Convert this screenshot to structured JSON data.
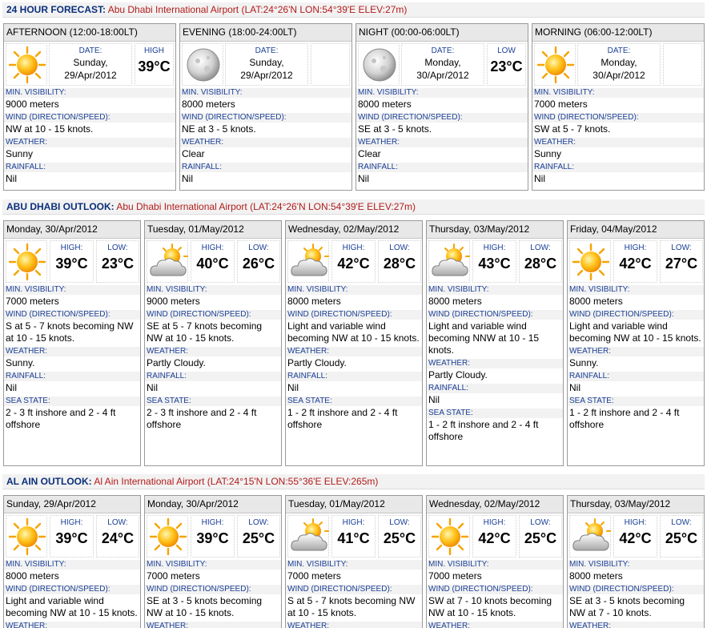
{
  "forecast24": {
    "title": "24 HOUR FORECAST:",
    "location": "Abu Dhabi International Airport (LAT:24°26'N LON:54°39'E ELEV:27m)",
    "cards": [
      {
        "period": "AFTERNOON (12:00-18:00LT)",
        "icon": "sun-icon",
        "date_label": "DATE:",
        "date_line1": "Sunday,",
        "date_line2": "29/Apr/2012",
        "temp_label": "HIGH",
        "temp": "39°C",
        "vis_label": "MIN. VISIBILITY:",
        "vis": "9000 meters",
        "wind_label": "WIND (DIRECTION/SPEED):",
        "wind": "NW at 10 - 15 knots.",
        "weather_label": "WEATHER:",
        "weather": "Sunny",
        "rain_label": "RAINFALL:",
        "rain": "Nil"
      },
      {
        "period": "EVENING (18:00-24:00LT)",
        "icon": "moon-icon",
        "date_label": "DATE:",
        "date_line1": "Sunday,",
        "date_line2": "29/Apr/2012",
        "temp_label": "",
        "temp": "",
        "vis_label": "MIN. VISIBILITY:",
        "vis": "8000 meters",
        "wind_label": "WIND (DIRECTION/SPEED):",
        "wind": "NE at 3 - 5 knots.",
        "weather_label": "WEATHER:",
        "weather": "Clear",
        "rain_label": "RAINFALL:",
        "rain": "Nil"
      },
      {
        "period": "NIGHT (00:00-06:00LT)",
        "icon": "moon-icon",
        "date_label": "DATE:",
        "date_line1": "Monday,",
        "date_line2": "30/Apr/2012",
        "temp_label": "LOW",
        "temp": "23°C",
        "vis_label": "MIN. VISIBILITY:",
        "vis": "8000 meters",
        "wind_label": "WIND (DIRECTION/SPEED):",
        "wind": "SE at 3 - 5 knots.",
        "weather_label": "WEATHER:",
        "weather": "Clear",
        "rain_label": "RAINFALL:",
        "rain": "Nil"
      },
      {
        "period": "MORNING (06:00-12:00LT)",
        "icon": "sun-icon",
        "date_label": "DATE:",
        "date_line1": "Monday,",
        "date_line2": "30/Apr/2012",
        "temp_label": "",
        "temp": "",
        "vis_label": "MIN. VISIBILITY:",
        "vis": "7000 meters",
        "wind_label": "WIND (DIRECTION/SPEED):",
        "wind": "SW at 5 - 7 knots.",
        "weather_label": "WEATHER:",
        "weather": "Sunny",
        "rain_label": "RAINFALL:",
        "rain": "Nil"
      }
    ]
  },
  "abudhabi": {
    "title": "ABU DHABI OUTLOOK:",
    "location": "Abu Dhabi International Airport (LAT:24°26'N LON:54°39'E ELEV:27m)",
    "cards": [
      {
        "day": "Monday, 30/Apr/2012",
        "icon": "sun-icon",
        "high_label": "HIGH:",
        "high": "39°C",
        "low_label": "LOW:",
        "low": "23°C",
        "vis_label": "MIN. VISIBILITY:",
        "vis": "7000 meters",
        "wind_label": "WIND (DIRECTION/SPEED):",
        "wind": "S at 5 - 7 knots becoming NW at 10 - 15 knots.",
        "weather_label": "WEATHER:",
        "weather": "Sunny.",
        "rain_label": "RAINFALL:",
        "rain": "Nil",
        "sea_label": "SEA STATE:",
        "sea": "2 - 3 ft inshore and 2 - 4 ft offshore"
      },
      {
        "day": "Tuesday, 01/May/2012",
        "icon": "partly-cloudy-icon",
        "high_label": "HIGH:",
        "high": "40°C",
        "low_label": "LOW:",
        "low": "26°C",
        "vis_label": "MIN. VISIBILITY:",
        "vis": "9000 meters",
        "wind_label": "WIND (DIRECTION/SPEED):",
        "wind": "SE at 5 - 7 knots becoming NW at 10 - 15 knots.",
        "weather_label": "WEATHER:",
        "weather": "Partly Cloudy.",
        "rain_label": "RAINFALL:",
        "rain": "Nil",
        "sea_label": "SEA STATE:",
        "sea": "2 - 3 ft inshore and 2 - 4 ft offshore"
      },
      {
        "day": "Wednesday, 02/May/2012",
        "icon": "partly-cloudy-icon",
        "high_label": "HIGH:",
        "high": "42°C",
        "low_label": "LOW:",
        "low": "28°C",
        "vis_label": "MIN. VISIBILITY:",
        "vis": "8000 meters",
        "wind_label": "WIND (DIRECTION/SPEED):",
        "wind": "Light and variable wind becoming NW at 10 - 15 knots.",
        "weather_label": "WEATHER:",
        "weather": "Partly Cloudy.",
        "rain_label": "RAINFALL:",
        "rain": "Nil",
        "sea_label": "SEA STATE:",
        "sea": "1 - 2 ft inshore and 2 - 4 ft offshore"
      },
      {
        "day": "Thursday, 03/May/2012",
        "icon": "partly-cloudy-icon",
        "high_label": "HIGH:",
        "high": "43°C",
        "low_label": "LOW:",
        "low": "28°C",
        "vis_label": "MIN. VISIBILITY:",
        "vis": "8000 meters",
        "wind_label": "WIND (DIRECTION/SPEED):",
        "wind": "Light and variable wind becoming NNW at 10 - 15 knots.",
        "weather_label": "WEATHER:",
        "weather": "Partly Cloudy.",
        "rain_label": "RAINFALL:",
        "rain": "Nil",
        "sea_label": "SEA STATE:",
        "sea": "1 - 2 ft inshore and 2 - 4 ft offshore"
      },
      {
        "day": "Friday, 04/May/2012",
        "icon": "sun-icon",
        "high_label": "HIGH:",
        "high": "42°C",
        "low_label": "LOW:",
        "low": "27°C",
        "vis_label": "MIN. VISIBILITY:",
        "vis": "8000 meters",
        "wind_label": "WIND (DIRECTION/SPEED):",
        "wind": "Light and variable wind becoming NW at 10 - 15 knots.",
        "weather_label": "WEATHER:",
        "weather": "Sunny.",
        "rain_label": "RAINFALL:",
        "rain": "Nil",
        "sea_label": "SEA STATE:",
        "sea": "1 - 2 ft inshore and 2 - 4 ft offshore"
      }
    ]
  },
  "alain": {
    "title": "AL AIN OUTLOOK:",
    "location": "Al Ain International Airport (LAT:24°15'N LON:55°36'E ELEV:265m)",
    "cards": [
      {
        "day": "Sunday, 29/Apr/2012",
        "icon": "sun-icon",
        "high_label": "HIGH:",
        "high": "39°C",
        "low_label": "LOW:",
        "low": "24°C",
        "vis_label": "MIN. VISIBILITY:",
        "vis": "8000 meters",
        "wind_label": "WIND (DIRECTION/SPEED):",
        "wind": "Light and variable wind becoming NW at 10 - 15 knots.",
        "weather_label": "WEATHER:"
      },
      {
        "day": "Monday, 30/Apr/2012",
        "icon": "sun-icon",
        "high_label": "HIGH:",
        "high": "39°C",
        "low_label": "LOW:",
        "low": "25°C",
        "vis_label": "MIN. VISIBILITY:",
        "vis": "7000 meters",
        "wind_label": "WIND (DIRECTION/SPEED):",
        "wind": "SE at 3 - 5 knots becoming NW at 10 - 15 knots.",
        "weather_label": "WEATHER:"
      },
      {
        "day": "Tuesday, 01/May/2012",
        "icon": "partly-cloudy-icon",
        "high_label": "HIGH:",
        "high": "41°C",
        "low_label": "LOW:",
        "low": "25°C",
        "vis_label": "MIN. VISIBILITY:",
        "vis": "7000 meters",
        "wind_label": "WIND (DIRECTION/SPEED):",
        "wind": "S at 5 - 7 knots becoming NW at 10 - 15 knots.",
        "weather_label": "WEATHER:"
      },
      {
        "day": "Wednesday, 02/May/2012",
        "icon": "sun-icon",
        "high_label": "HIGH:",
        "high": "42°C",
        "low_label": "LOW:",
        "low": "25°C",
        "vis_label": "MIN. VISIBILITY:",
        "vis": "7000 meters",
        "wind_label": "WIND (DIRECTION/SPEED):",
        "wind": "SW at 7 - 10 knots becoming NW at 10 - 15 knots.",
        "weather_label": "WEATHER:"
      },
      {
        "day": "Thursday, 03/May/2012",
        "icon": "partly-cloudy-icon",
        "high_label": "HIGH:",
        "high": "42°C",
        "low_label": "LOW:",
        "low": "25°C",
        "vis_label": "MIN. VISIBILITY:",
        "vis": "8000 meters",
        "wind_label": "WIND (DIRECTION/SPEED):",
        "wind": "SE at 3 - 5 knots becoming NW at 7 - 10 knots.",
        "weather_label": "WEATHER:"
      }
    ]
  }
}
